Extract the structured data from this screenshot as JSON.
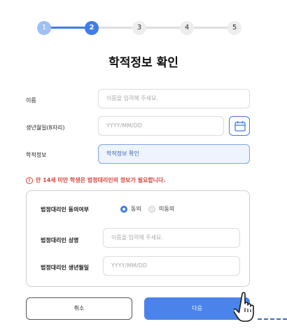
{
  "stepper": {
    "steps": [
      "1",
      "2",
      "3",
      "4",
      "5"
    ],
    "current": 2
  },
  "page_title": "학적정보 확인",
  "form": {
    "name": {
      "label": "이름",
      "placeholder": "이름을 입력해 주세요."
    },
    "birth": {
      "label": "생년월일(8자리)",
      "placeholder": "YYYY/MM/DD"
    },
    "academic": {
      "label": "학적정보",
      "button_label": "학적정보 확인"
    }
  },
  "warning": {
    "icon": "!",
    "text": "만 14세 미만 학생은 법정대리인의 정보가 필요합니다."
  },
  "guardian": {
    "consent_label": "법정대리인 동의여부",
    "consent_options": [
      "동의",
      "미동의"
    ],
    "consent_selected": "동의",
    "name_label": "법정대리인 성명",
    "name_placeholder": "이름을 입력해 주세요.",
    "birth_label": "법정대리인 생년월일",
    "birth_placeholder": "YYYY/MM/DD"
  },
  "actions": {
    "cancel_label": "취소",
    "next_label": "다음"
  },
  "colors": {
    "accent": "#3f7de8",
    "accent_light": "#9ec0f3",
    "warning": "#d9443a"
  }
}
